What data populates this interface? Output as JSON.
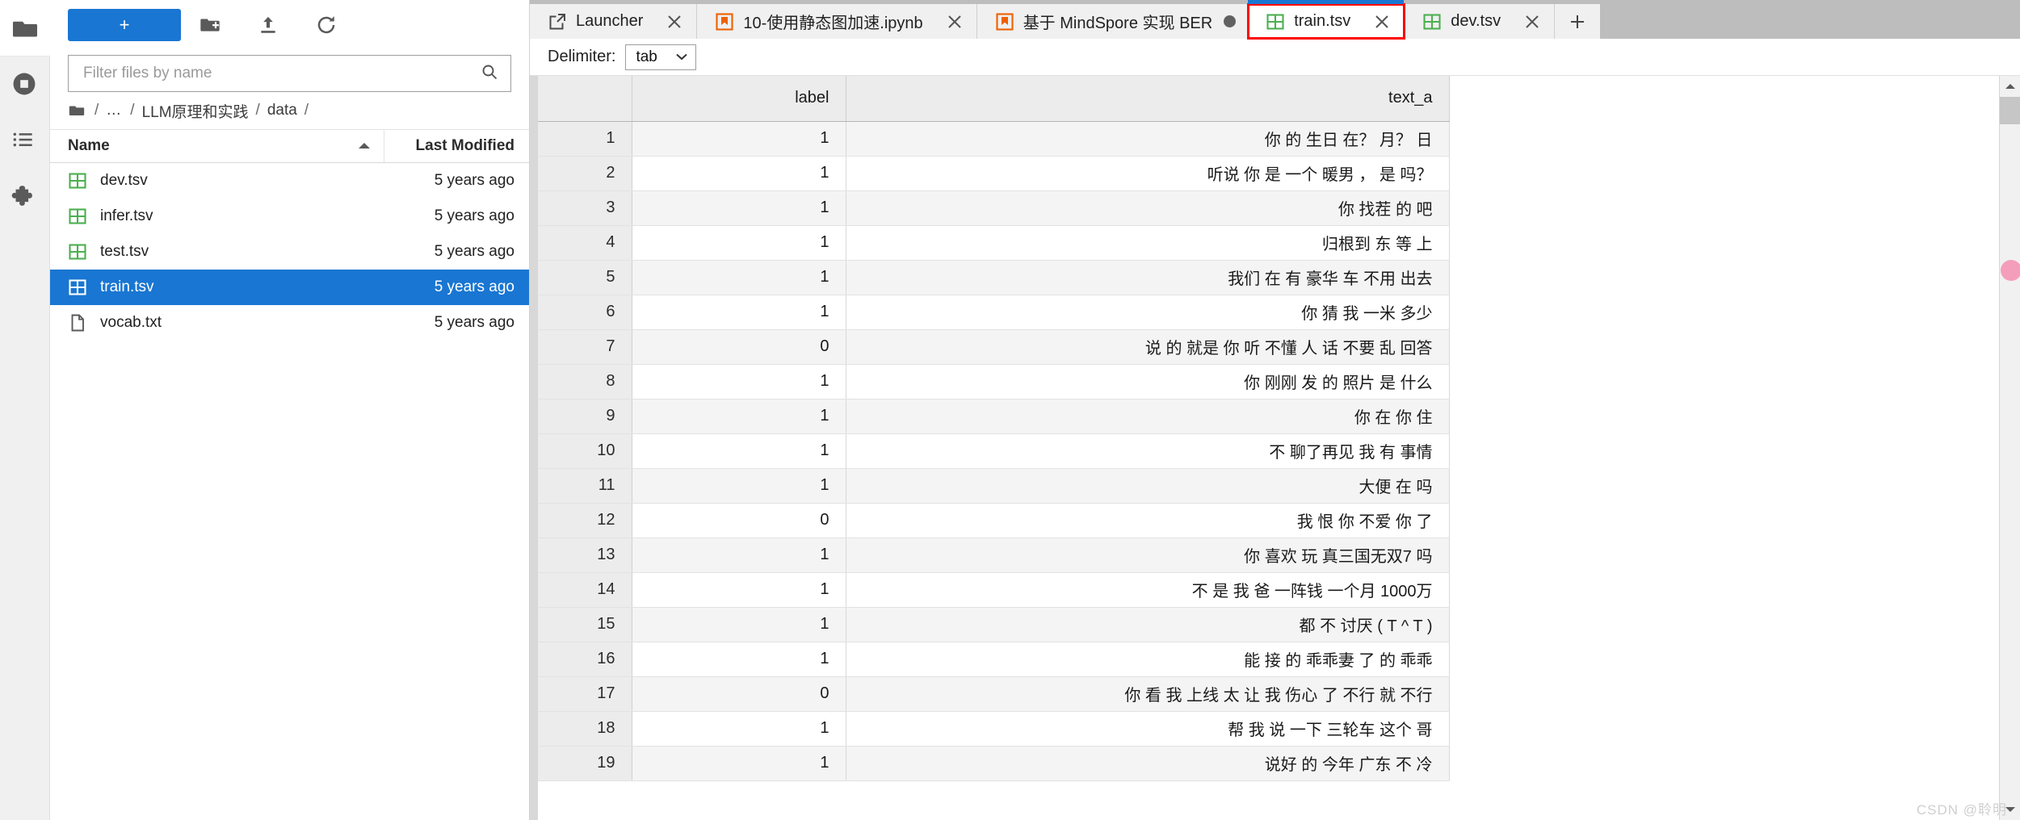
{
  "activity_bar": {
    "items": [
      {
        "name": "file-browser",
        "icon": "folder-icon",
        "active": true
      },
      {
        "name": "running-kernels",
        "icon": "stop-circle-icon",
        "active": false
      },
      {
        "name": "commands",
        "icon": "list-icon",
        "active": false
      },
      {
        "name": "extension-manager",
        "icon": "puzzle-icon",
        "active": false
      }
    ]
  },
  "file_browser": {
    "new_launcher_label": "+",
    "toolbar_icons": [
      "new-folder-icon",
      "upload-icon",
      "refresh-icon"
    ],
    "filter": {
      "placeholder": "Filter files by name",
      "value": ""
    },
    "breadcrumbs": [
      "/",
      "…",
      "/",
      "LLM原理和实践",
      "/",
      "data",
      "/"
    ],
    "breadcrumb_items": [
      {
        "label": "…"
      },
      {
        "label": "LLM原理和实践"
      },
      {
        "label": "data"
      }
    ],
    "columns": {
      "name": "Name",
      "last_modified": "Last Modified"
    },
    "sort": "ascending",
    "files": [
      {
        "name": "dev.tsv",
        "modified": "5 years ago",
        "icon": "table-file-icon",
        "selected": false
      },
      {
        "name": "infer.tsv",
        "modified": "5 years ago",
        "icon": "table-file-icon",
        "selected": false
      },
      {
        "name": "test.tsv",
        "modified": "5 years ago",
        "icon": "table-file-icon",
        "selected": false
      },
      {
        "name": "train.tsv",
        "modified": "5 years ago",
        "icon": "table-file-icon",
        "selected": true
      },
      {
        "name": "vocab.txt",
        "modified": "5 years ago",
        "icon": "text-file-icon",
        "selected": false
      }
    ]
  },
  "tabs": {
    "items": [
      {
        "label": "Launcher",
        "icon": "launcher-icon",
        "current": false,
        "dirty": false,
        "closable": true,
        "highlight": false
      },
      {
        "label": "10-使用静态图加速.ipynb",
        "icon": "notebook-icon",
        "current": false,
        "dirty": false,
        "closable": true,
        "highlight": false
      },
      {
        "label": "基于 MindSpore 实现 BER",
        "icon": "notebook-icon",
        "current": false,
        "dirty": true,
        "closable": false,
        "highlight": false
      },
      {
        "label": "train.tsv",
        "icon": "table-file-icon",
        "current": true,
        "dirty": false,
        "closable": true,
        "highlight": true
      },
      {
        "label": "dev.tsv",
        "icon": "table-file-icon",
        "current": false,
        "dirty": false,
        "closable": true,
        "highlight": false
      }
    ],
    "add_tab_label": "+"
  },
  "csv_toolbar": {
    "delimiter_label": "Delimiter:",
    "delimiter_value": "tab"
  },
  "grid": {
    "columns": [
      "",
      "label",
      "text_a"
    ],
    "rows": [
      {
        "index": "1",
        "label": "1",
        "text_a": "你 的 生日 在？ 月？ 日"
      },
      {
        "index": "2",
        "label": "1",
        "text_a": "听说 你 是 一个 暖男 ， 是 吗？"
      },
      {
        "index": "3",
        "label": "1",
        "text_a": "你 找茬 的 吧"
      },
      {
        "index": "4",
        "label": "1",
        "text_a": "归根到 东 等 上"
      },
      {
        "index": "5",
        "label": "1",
        "text_a": "我们 在 有 豪华 车 不用 出去"
      },
      {
        "index": "6",
        "label": "1",
        "text_a": "你 猜 我 一米 多少"
      },
      {
        "index": "7",
        "label": "0",
        "text_a": "说 的 就是 你 听 不懂 人 话 不要 乱 回答"
      },
      {
        "index": "8",
        "label": "1",
        "text_a": "你 刚刚 发 的 照片 是 什么"
      },
      {
        "index": "9",
        "label": "1",
        "text_a": "你 在 你 住"
      },
      {
        "index": "10",
        "label": "1",
        "text_a": "不 聊了再见 我 有 事情"
      },
      {
        "index": "11",
        "label": "1",
        "text_a": "大便 在 吗"
      },
      {
        "index": "12",
        "label": "0",
        "text_a": "我 恨 你 不爱 你 了"
      },
      {
        "index": "13",
        "label": "1",
        "text_a": "你 喜欢 玩 真三国无双7 吗"
      },
      {
        "index": "14",
        "label": "1",
        "text_a": "不 是 我 爸 一阵钱 一个月 1000万"
      },
      {
        "index": "15",
        "label": "1",
        "text_a": "都 不 讨厌 ( T ^ T )"
      },
      {
        "index": "16",
        "label": "1",
        "text_a": "能 接 的 乖乖妻 了 的 乖乖"
      },
      {
        "index": "17",
        "label": "0",
        "text_a": "你 看 我 上线 太 让 我 伤心 了 不行 就 不行"
      },
      {
        "index": "18",
        "label": "1",
        "text_a": "帮 我 说 一下 三轮车 这个 哥"
      },
      {
        "index": "19",
        "label": "1",
        "text_a": "说好 的 今年 广东 不 冷"
      }
    ]
  },
  "watermark": {
    "text": "CSDN @聆明"
  },
  "colors": {
    "accent_blue": "#1976d2",
    "tab_highlight_red": "#ff0000",
    "file_icon_green": "#4caf50",
    "notebook_icon_orange": "#ee6002",
    "tabbar_bg": "#bdbdbd"
  }
}
